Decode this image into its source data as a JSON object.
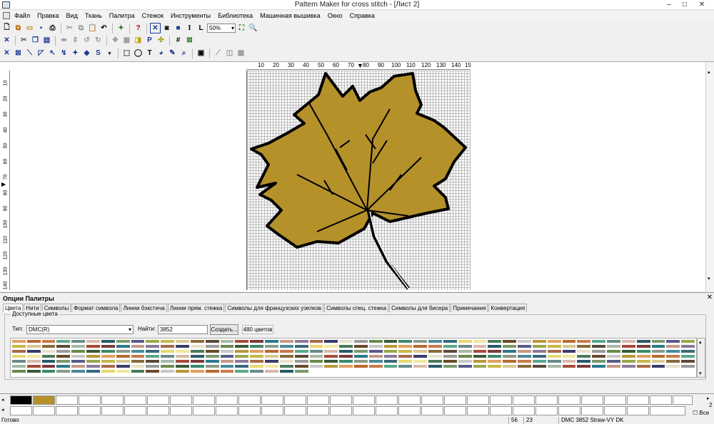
{
  "window": {
    "title": "Pattern Maker for cross stitch - [Лист 2]"
  },
  "menu": [
    "Файл",
    "Правка",
    "Вид",
    "Ткань",
    "Палитра",
    "Стежок",
    "Инструменты",
    "Библиотека",
    "Машинная вышивка",
    "Окно",
    "Справка"
  ],
  "toolbar": {
    "zoom_value": "50%"
  },
  "ruler": {
    "horizontal": [
      "10",
      "20",
      "30",
      "40",
      "50",
      "60",
      "70",
      "80",
      "90",
      "100",
      "110",
      "120",
      "130",
      "140",
      "15"
    ],
    "vertical": [
      "10",
      "20",
      "30",
      "40",
      "50",
      "60",
      "70",
      "80",
      "90",
      "100",
      "110",
      "120",
      "130",
      "140"
    ]
  },
  "palette_panel": {
    "title": "Опции Палитры",
    "tabs": [
      "Цвета",
      "Нити",
      "Символы",
      "Формат символа",
      "Линии бэкстича",
      "Линии прям. стежка",
      "Символы для французских узелков",
      "Символы спец. стежка",
      "Символы для бисера",
      "Примечания",
      "Конвертация"
    ],
    "available_colors_label": "Доступные цвета",
    "type_label": "Тип:",
    "type_value": "DMC(R)",
    "find_label": "Найти:",
    "find_value": "3852",
    "create_button": "Создать...",
    "color_count": "480 цветов"
  },
  "used_colors": {
    "colors": [
      "#000000",
      "#b5912a"
    ],
    "all_label": "Все",
    "number": "2"
  },
  "colors": {
    "leaf_fill": "#b5912a",
    "outline": "#000000",
    "accent": "#1c3a96"
  },
  "status": {
    "ready": "Готово",
    "x": "56",
    "y": "23",
    "thread": "DMC  3852  Straw-VY DK"
  }
}
